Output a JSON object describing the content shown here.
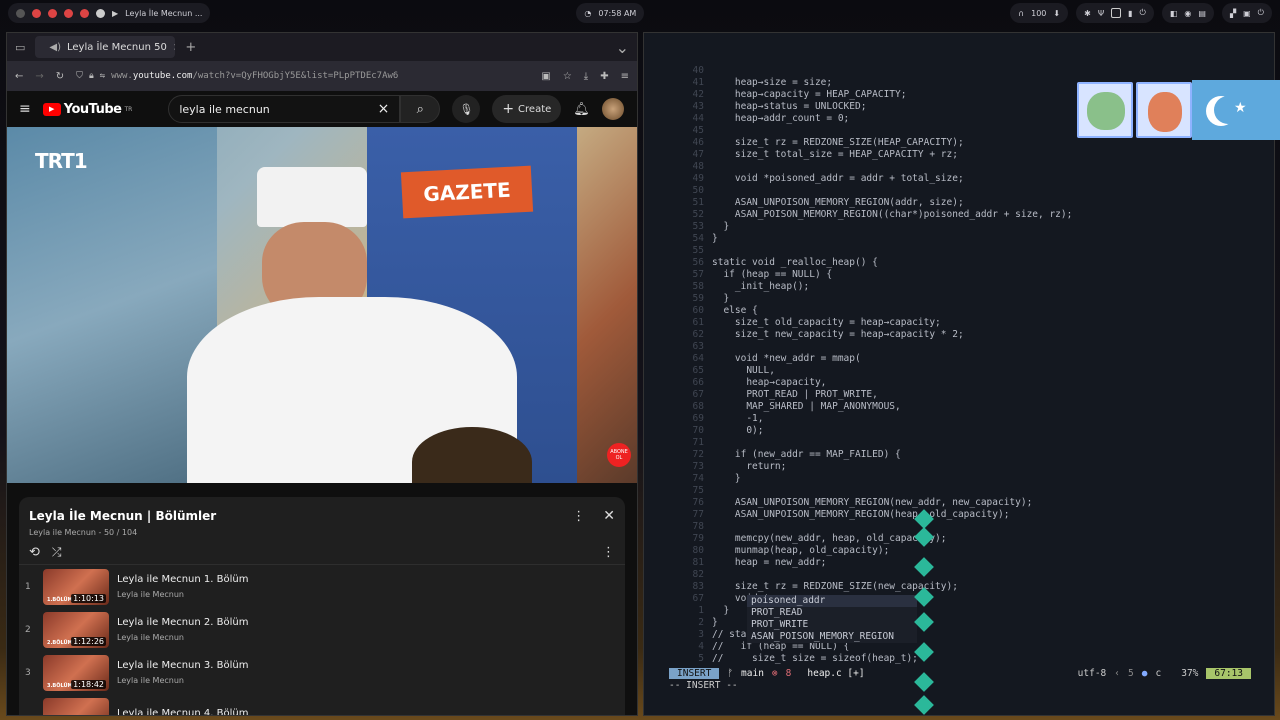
{
  "topbar": {
    "window_title": "Leyla İle Mecnun ...",
    "clock": "07:58 AM",
    "volume": "100"
  },
  "browser": {
    "tab_title": "Leyla İle Mecnun 50",
    "url_prefix": "www.",
    "url_domain": "youtube.com",
    "url_rest": "/watch?v=QyFHOGbjY5E&list=PLpPTDEc7Aw6"
  },
  "youtube": {
    "logo": "YouTube",
    "region": "TR",
    "search_value": "leyla ile mecnun",
    "create_label": "Create",
    "channel_logo": "TRT1",
    "video_sign": "GAZETE",
    "subscribe_badge": "ABONE OL",
    "playlist": {
      "title": "Leyla İle Mecnun | Bölümler",
      "subtitle": "Leyla ile Mecnun - 50 / 104",
      "items": [
        {
          "num": "1",
          "title": "Leyla ile Mecnun 1. Bölüm",
          "channel": "Leyla ile Mecnun",
          "duration": "1:10:13",
          "badge": "1.BÖLÜM"
        },
        {
          "num": "2",
          "title": "Leyla ile Mecnun 2. Bölüm",
          "channel": "Leyla ile Mecnun",
          "duration": "1:12:26",
          "badge": "2.BÖLÜM"
        },
        {
          "num": "3",
          "title": "Leyla ile Mecnun 3. Bölüm",
          "channel": "Leyla ile Mecnun",
          "duration": "1:18:42",
          "badge": "3.BÖLÜM"
        },
        {
          "num": "",
          "title": "Leyla ile Mecnun 4. Bölüm",
          "channel": "",
          "duration": "",
          "badge": ""
        }
      ]
    }
  },
  "editor": {
    "lines": [
      {
        "n": "40",
        "t": ""
      },
      {
        "n": "41",
        "t": "    heap→size = size;"
      },
      {
        "n": "42",
        "t": "    heap→capacity = HEAP_CAPACITY;"
      },
      {
        "n": "43",
        "t": "    heap→status = UNLOCKED;"
      },
      {
        "n": "44",
        "t": "    heap→addr_count = 0;"
      },
      {
        "n": "45",
        "t": ""
      },
      {
        "n": "46",
        "t": "    size_t rz = REDZONE_SIZE(HEAP_CAPACITY);"
      },
      {
        "n": "47",
        "t": "    size_t total_size = HEAP_CAPACITY + rz;"
      },
      {
        "n": "48",
        "t": ""
      },
      {
        "n": "49",
        "t": "    void *poisoned_addr = addr + total_size;"
      },
      {
        "n": "50",
        "t": ""
      },
      {
        "n": "51",
        "t": "    ASAN_UNPOISON_MEMORY_REGION(addr, size);"
      },
      {
        "n": "52",
        "t": "    ASAN_POISON_MEMORY_REGION((char*)poisoned_addr + size, rz);"
      },
      {
        "n": "53",
        "t": "  }"
      },
      {
        "n": "54",
        "t": "}"
      },
      {
        "n": "55",
        "t": ""
      },
      {
        "n": "56",
        "t": "static void _realloc_heap() {"
      },
      {
        "n": "57",
        "t": "  if (heap == NULL) {"
      },
      {
        "n": "58",
        "t": "    _init_heap();"
      },
      {
        "n": "59",
        "t": "  }"
      },
      {
        "n": "60",
        "t": "  else {"
      },
      {
        "n": "61",
        "t": "    size_t old_capacity = heap→capacity;"
      },
      {
        "n": "62",
        "t": "    size_t new_capacity = heap→capacity * 2;"
      },
      {
        "n": "63",
        "t": ""
      },
      {
        "n": "64",
        "t": "    void *new_addr = mmap("
      },
      {
        "n": "65",
        "t": "      NULL,"
      },
      {
        "n": "66",
        "t": "      heap→capacity,"
      },
      {
        "n": "67",
        "t": "      PROT_READ | PROT_WRITE,"
      },
      {
        "n": "68",
        "t": "      MAP_SHARED | MAP_ANONYMOUS,"
      },
      {
        "n": "69",
        "t": "      -1,"
      },
      {
        "n": "70",
        "t": "      0);"
      },
      {
        "n": "71",
        "t": ""
      },
      {
        "n": "72",
        "t": "    if (new_addr == MAP_FAILED) {"
      },
      {
        "n": "73",
        "t": "      return;"
      },
      {
        "n": "74",
        "t": "    }"
      },
      {
        "n": "75",
        "t": ""
      },
      {
        "n": "76",
        "t": "    ASAN_UNPOISON_MEMORY_REGION(new_addr, new_capacity);"
      },
      {
        "n": "77",
        "t": "    ASAN_UNPOISON_MEMORY_REGION(heap, old_capacity);"
      },
      {
        "n": "78",
        "t": ""
      },
      {
        "n": "79",
        "t": "    memcpy(new_addr, heap, old_capacity);"
      },
      {
        "n": "80",
        "t": "    munmap(heap, old_capacity);"
      },
      {
        "n": "81",
        "t": "    heap = new_addr;"
      },
      {
        "n": "82",
        "t": ""
      },
      {
        "n": "83",
        "t": "    size_t rz = REDZONE_SIZE(new_capacity);"
      },
      {
        "n": "67",
        "t": "    void *po"
      },
      {
        "n": "1",
        "t": "  }"
      },
      {
        "n": "2",
        "t": "}"
      },
      {
        "n": "3",
        "t": "// static void _"
      },
      {
        "n": "4",
        "t": "//   if (heap == NULL) {"
      },
      {
        "n": "5",
        "t": "//     size_t size = sizeof(heap_t);"
      }
    ],
    "completion": [
      "poisoned_addr",
      "PROT_READ",
      "PROT_WRITE",
      "ASAN_POISON_MEMORY_REGION"
    ],
    "status": {
      "mode": "INSERT",
      "branch": "main",
      "errors": "8",
      "file": "heap.c [+]",
      "encoding": "utf-8",
      "warnings": "5",
      "lang": "c",
      "percent": "37%",
      "position": "67:13"
    },
    "cmdline": "-- INSERT --"
  }
}
